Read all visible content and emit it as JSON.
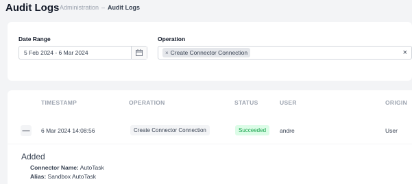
{
  "header": {
    "title": "Audit Logs",
    "breadcrumb": [
      "Administration",
      "–",
      "Audit Logs"
    ]
  },
  "filters": {
    "date_range_label": "Date Range",
    "date_range_value": "5 Feb 2024 - 6 Mar 2024",
    "operation_label": "Operation",
    "operation_chip": "Create Connector Connection",
    "chip_remove": "×",
    "clear": "×"
  },
  "table": {
    "columns": [
      "TIMESTAMP",
      "OPERATION",
      "STATUS",
      "USER",
      "ORIGIN"
    ],
    "rows": [
      {
        "expand": "—",
        "timestamp": "6 Mar 2024 14:08:56",
        "operation": "Create Connector Connection",
        "status": "Succeeded",
        "user": "andre",
        "origin": "User"
      }
    ]
  },
  "details": {
    "title": "Added",
    "lines": [
      {
        "key": "Connector Name:",
        "value": "AutoTask"
      },
      {
        "key": "Alias:",
        "value": "Sandbox AutoTask"
      }
    ]
  },
  "colors": {
    "status_success_bg": "#dcfce7",
    "status_success_text": "#16a34a"
  },
  "icons": {
    "date_picker": "calendar-icon",
    "clear": "close-icon"
  }
}
